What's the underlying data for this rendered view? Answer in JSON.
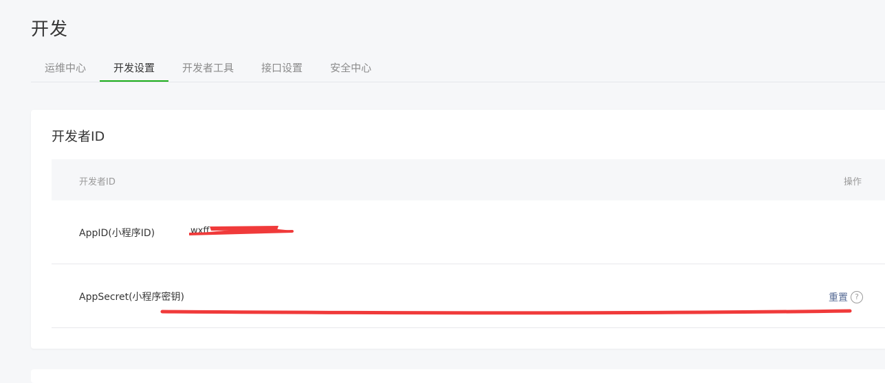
{
  "page": {
    "title": "开发"
  },
  "tabs": [
    {
      "label": "运维中心"
    },
    {
      "label": "开发设置"
    },
    {
      "label": "开发者工具"
    },
    {
      "label": "接口设置"
    },
    {
      "label": "安全中心"
    }
  ],
  "active_tab": "开发设置",
  "developer_id": {
    "title": "开发者ID",
    "columns": {
      "name": "开发者ID",
      "action": "操作"
    },
    "rows": [
      {
        "label": "AppID(小程序ID)",
        "value": "wxff"
      },
      {
        "label": "AppSecret(小程序密钥)",
        "action": "重置",
        "help": "?"
      }
    ]
  },
  "colors": {
    "accent_green": "#1aad19",
    "link_blue": "#576b95",
    "redaction_red": "#f03a3a"
  }
}
